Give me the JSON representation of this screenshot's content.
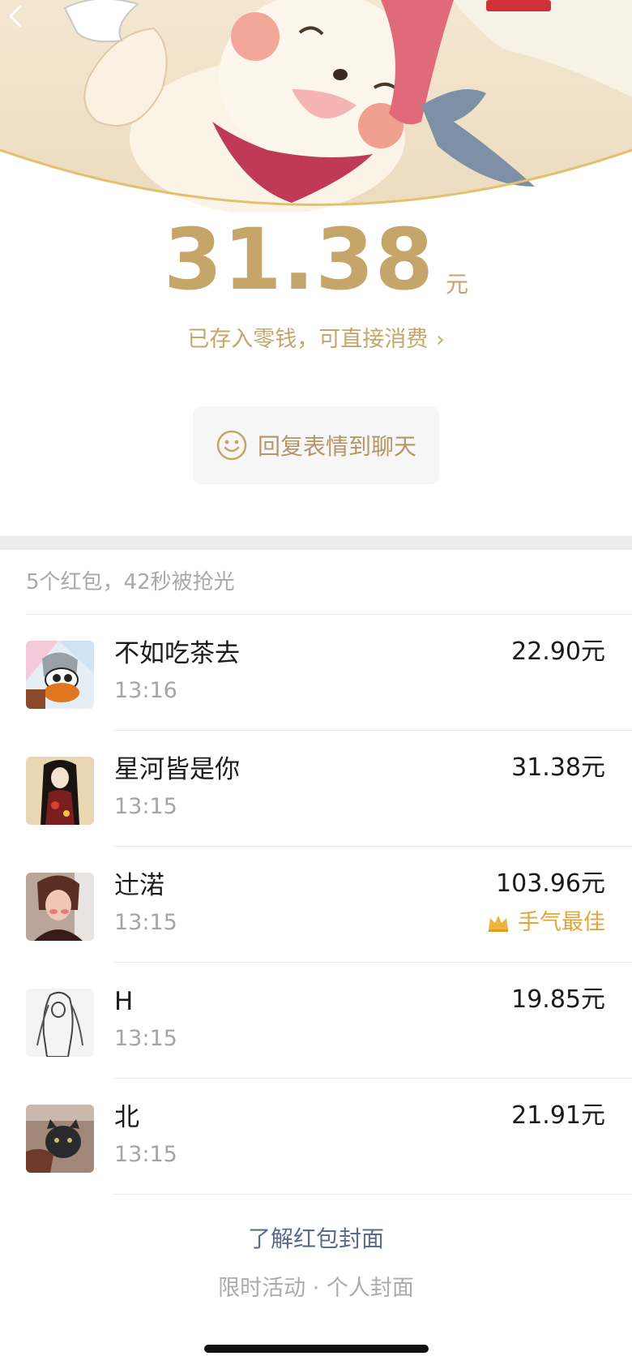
{
  "header": {
    "cover_image": "red-envelope-cover-illustration",
    "back_icon": "chevron-left-icon"
  },
  "received": {
    "amount": "31.38",
    "unit": "元",
    "saved_text": "已存入零钱，可直接消费",
    "saved_chevron": "›"
  },
  "reply_button": {
    "icon": "smile-icon",
    "label": "回复表情到聊天"
  },
  "summary": "5个红包，42秒被抢光",
  "recipients": [
    {
      "name": "不如吃茶去",
      "time": "13:16",
      "amount": "22.90元",
      "best": ""
    },
    {
      "name": "星河皆是你",
      "time": "13:15",
      "amount": "31.38元",
      "best": ""
    },
    {
      "name": "辻渃",
      "time": "13:15",
      "amount": "103.96元",
      "best": "手气最佳"
    },
    {
      "name": "H",
      "time": "13:15",
      "amount": "19.85元",
      "best": ""
    },
    {
      "name": "北",
      "time": "13:15",
      "amount": "21.91元",
      "best": ""
    }
  ],
  "footer": {
    "learn_link": "了解红包封面",
    "promo": "限时活动 · 个人封面"
  },
  "colors": {
    "gold": "#c5a56a",
    "best_orange": "#e0a63a",
    "link_blue": "#5b6b8f"
  }
}
